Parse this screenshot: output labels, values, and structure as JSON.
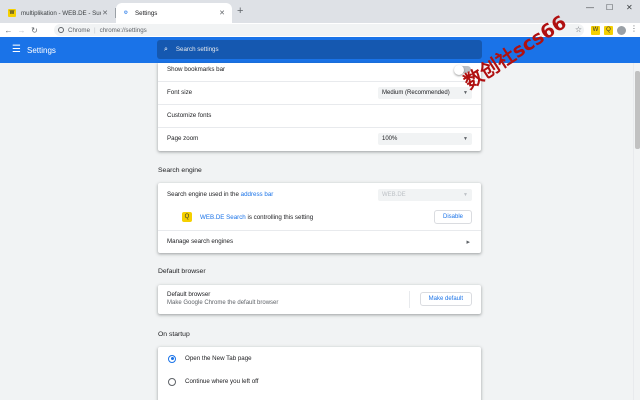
{
  "tabs": [
    {
      "title": "multiplikation - WEB.DE - Suche",
      "favicon": "webde-icon",
      "favicon_text": "W"
    },
    {
      "title": "Settings",
      "favicon": "gear-icon",
      "favicon_glyph": "⚙"
    }
  ],
  "window_controls": {
    "minimize": "—",
    "maximize": "☐",
    "close": "✕"
  },
  "toolbar": {
    "back": "←",
    "forward": "→",
    "reload": "↻",
    "omnibox_label": "Chrome",
    "omnibox_sep": "|",
    "omnibox_url": "chrome://settings",
    "bookmark_star": "☆",
    "ext_webde_text": "W",
    "ext_q_text": "Q",
    "menu_dots": "⋮"
  },
  "header": {
    "hamburger": "☰",
    "title": "Settings",
    "search_glyph": "⌕",
    "search_placeholder": "Search settings"
  },
  "appearance": {
    "show_bookmarks_bar": "Show bookmarks bar",
    "show_bookmarks_bar_on": false,
    "font_size_label": "Font size",
    "font_size_value": "Medium (Recommended)",
    "customize_fonts": "Customize fonts",
    "page_zoom_label": "Page zoom",
    "page_zoom_value": "100%"
  },
  "search_engine": {
    "section_title": "Search engine",
    "label_prefix": "Search engine used in the",
    "label_link": "address bar",
    "selected": "WEB.DE",
    "ext_name": "WEB.DE Search",
    "ext_text": " is controlling this setting",
    "disable_button": "Disable",
    "manage_label": "Manage search engines"
  },
  "default_browser": {
    "section_title": "Default browser",
    "title": "Default browser",
    "subtitle": "Make Google Chrome the default browser",
    "button": "Make default"
  },
  "on_startup": {
    "section_title": "On startup",
    "options": [
      {
        "label": "Open the New Tab page",
        "selected": true
      },
      {
        "label": "Continue where you left off",
        "selected": false
      }
    ]
  },
  "glyphs": {
    "dropdown_arrow": "▼",
    "chevron_right": "▸",
    "tab_close": "✕",
    "new_tab": "+"
  },
  "watermark": "数创社scs66",
  "colors": {
    "accent": "#1a73e8",
    "header_search": "#1558b0",
    "extension_yellow": "#f5d000"
  }
}
